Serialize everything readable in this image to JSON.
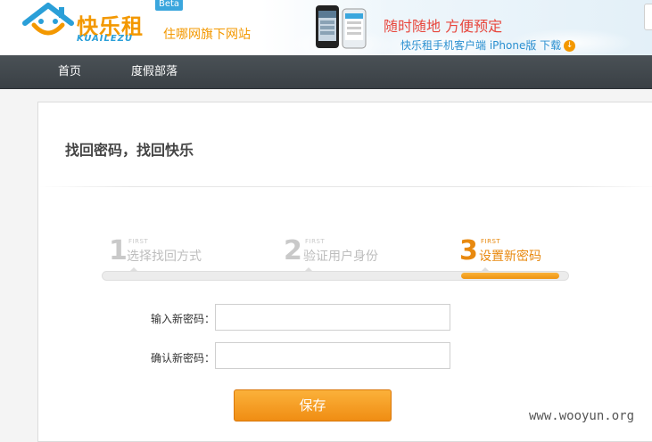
{
  "header": {
    "logo_cn": "快乐租",
    "logo_en": "KUAILEZU",
    "beta": "Beta",
    "tagline": "住哪网旗下网站",
    "promo_title": "随时随地 方便预定",
    "promo_link": "快乐租手机客户端 iPhone版 下载",
    "download_icon": "download-arrow-icon"
  },
  "nav": {
    "items": [
      {
        "label": "首页"
      },
      {
        "label": "度假部落"
      }
    ]
  },
  "panel": {
    "title": "找回密码，找回快乐",
    "steps": [
      {
        "num": "1",
        "small": "FIRST",
        "label": "选择找回方式",
        "active": false
      },
      {
        "num": "2",
        "small": "FIRST",
        "label": "验证用户身份",
        "active": false
      },
      {
        "num": "3",
        "small": "FIRST",
        "label": "设置新密码",
        "active": true
      }
    ],
    "form": {
      "new_password_label": "输入新密码：",
      "new_password_value": "",
      "confirm_password_label": "确认新密码：",
      "confirm_password_value": ""
    },
    "save_label": "保存"
  },
  "watermark": "www.wooyun.org",
  "colors": {
    "brand_orange": "#f39800",
    "brand_blue": "#2a9fd8",
    "nav_bg": "#3f464b",
    "active_step": "#e8890f"
  }
}
